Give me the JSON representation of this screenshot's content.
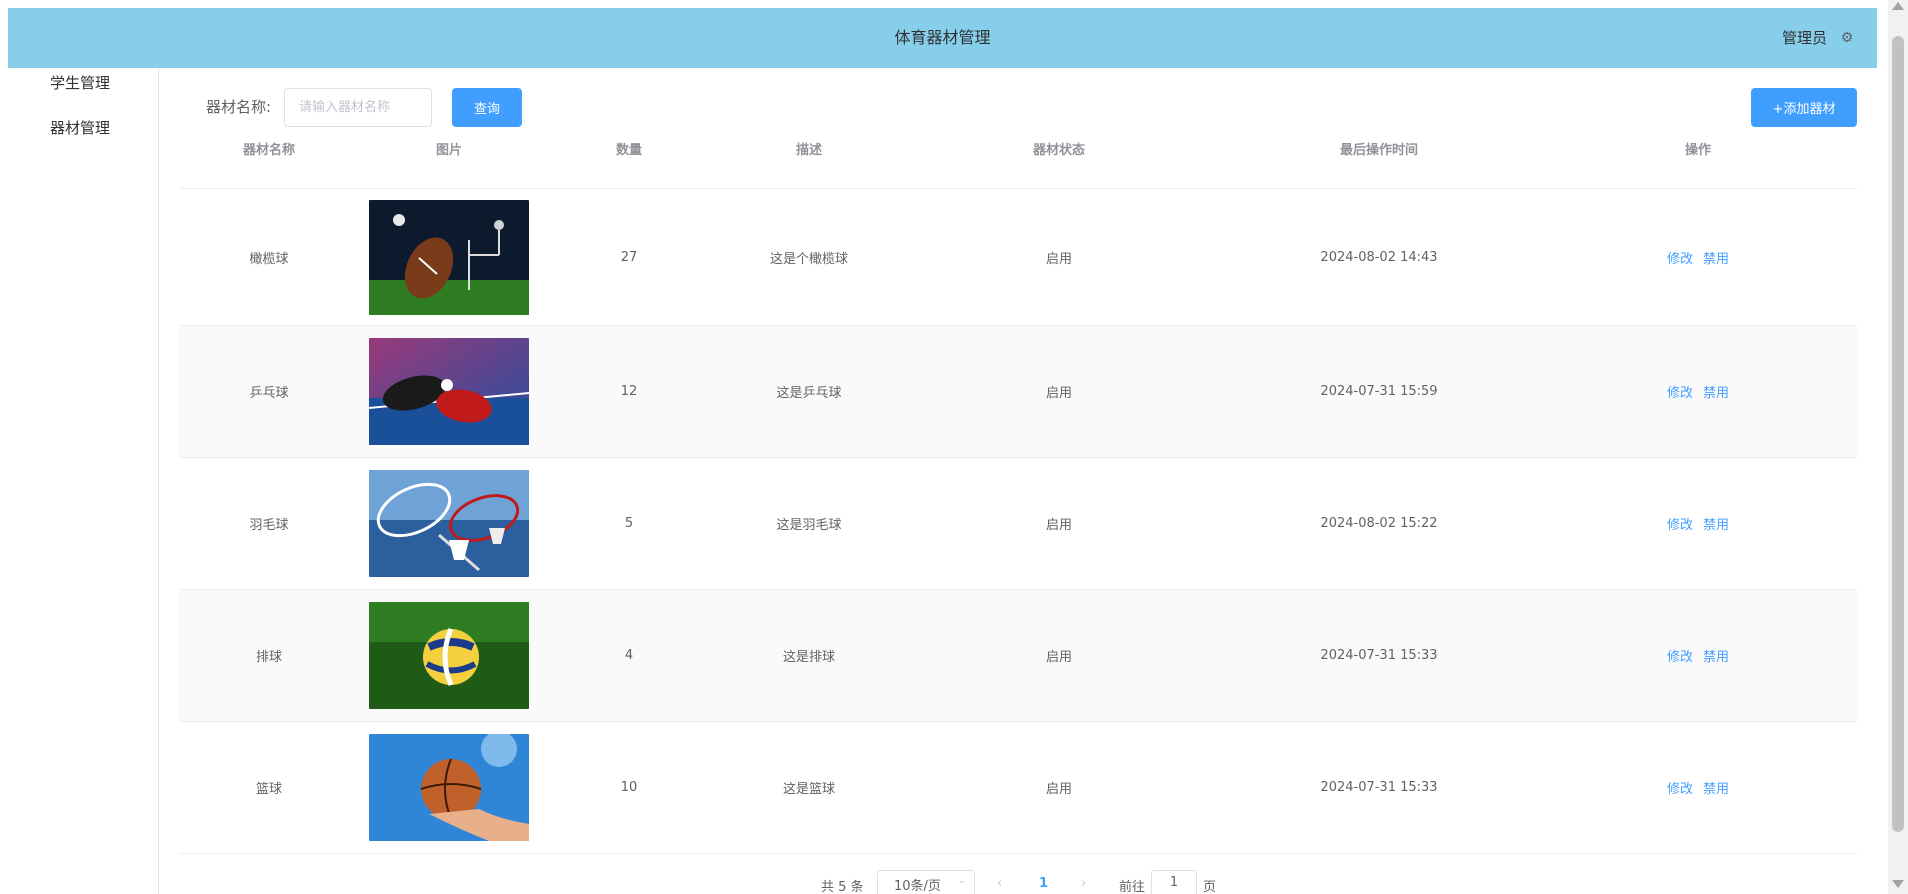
{
  "header": {
    "title": "体育器材管理",
    "user": "管理员",
    "bg_color": "#87ceeb"
  },
  "sidebar": {
    "items": [
      {
        "label": "学生管理"
      },
      {
        "label": "器材管理"
      }
    ]
  },
  "search": {
    "label": "器材名称:",
    "placeholder": "请输入器材名称",
    "value": "",
    "query_label": "查询",
    "add_label": "+添加器材"
  },
  "table": {
    "columns": [
      "器材名称",
      "图片",
      "数量",
      "描述",
      "器材状态",
      "最后操作时间",
      "操作"
    ],
    "rows": [
      {
        "name": "橄榄球",
        "image": "american-football-photo",
        "qty": "27",
        "desc": "这是个橄榄球",
        "status": "启用",
        "time": "2024-08-02 14:43",
        "edit": "修改",
        "disable": "禁用"
      },
      {
        "name": "乒乓球",
        "image": "table-tennis-photo",
        "qty": "12",
        "desc": "这是乒乓球",
        "status": "启用",
        "time": "2024-07-31 15:59",
        "edit": "修改",
        "disable": "禁用"
      },
      {
        "name": "羽毛球",
        "image": "badminton-photo",
        "qty": "5",
        "desc": "这是羽毛球",
        "status": "启用",
        "time": "2024-08-02 15:22",
        "edit": "修改",
        "disable": "禁用"
      },
      {
        "name": "排球",
        "image": "volleyball-photo",
        "qty": "4",
        "desc": "这是排球",
        "status": "启用",
        "time": "2024-07-31 15:33",
        "edit": "修改",
        "disable": "禁用"
      },
      {
        "name": "篮球",
        "image": "basketball-photo",
        "qty": "10",
        "desc": "这是篮球",
        "status": "启用",
        "time": "2024-07-31 15:33",
        "edit": "修改",
        "disable": "禁用"
      }
    ]
  },
  "pagination": {
    "total": "共 5 条",
    "page_size": "10条/页",
    "current_page": "1",
    "goto_label": "前往",
    "goto_value": "1",
    "unit": "页"
  },
  "colors": {
    "accent": "#409eff",
    "header": "#87ceeb"
  }
}
